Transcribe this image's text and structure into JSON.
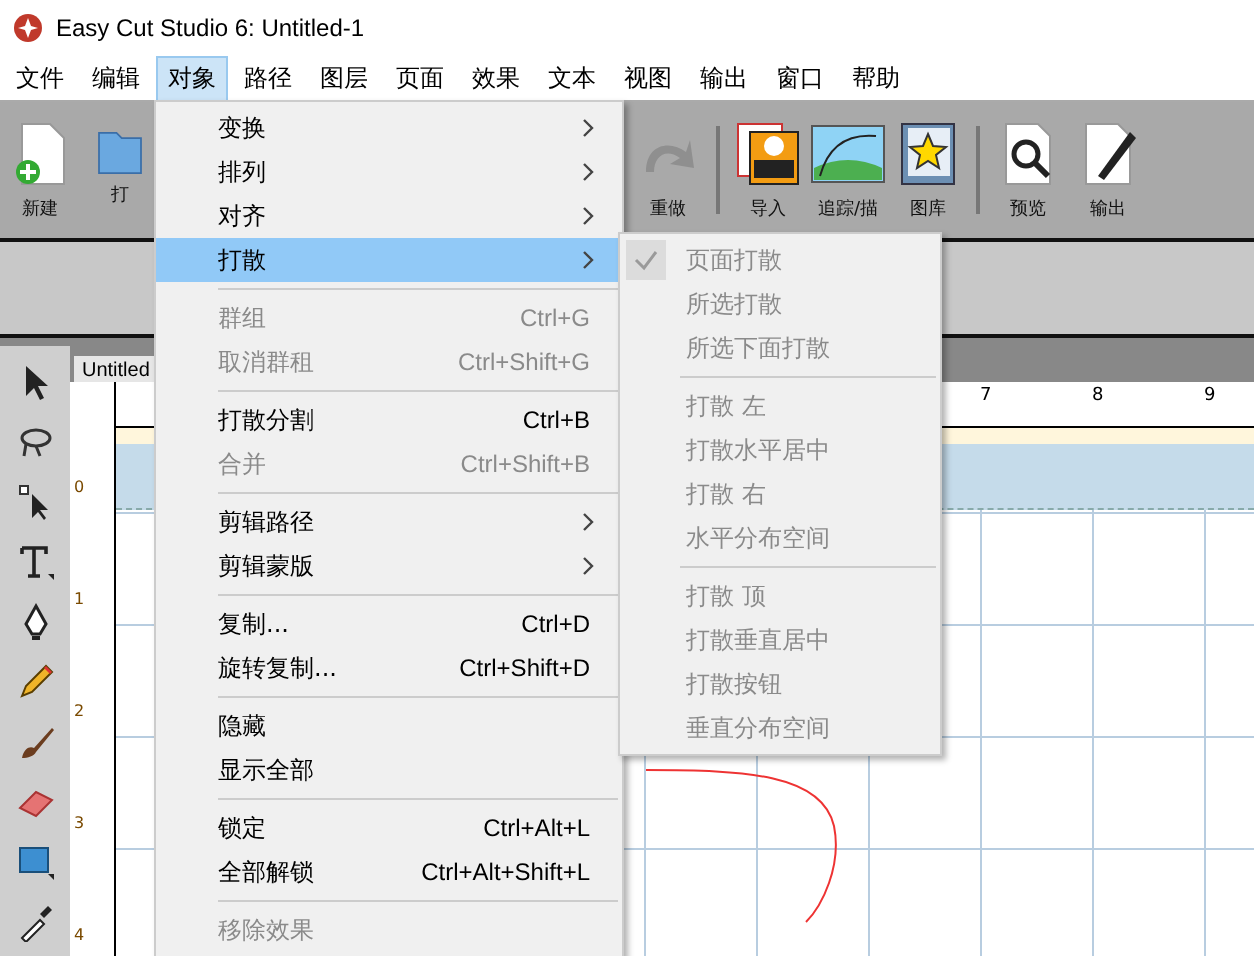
{
  "window": {
    "title": "Easy Cut Studio 6: Untitled-1"
  },
  "menu_bar": [
    {
      "label": "文件",
      "selected": false
    },
    {
      "label": "编辑",
      "selected": false
    },
    {
      "label": "对象",
      "selected": true
    },
    {
      "label": "路径",
      "selected": false
    },
    {
      "label": "图层",
      "selected": false
    },
    {
      "label": "页面",
      "selected": false
    },
    {
      "label": "效果",
      "selected": false
    },
    {
      "label": "文本",
      "selected": false
    },
    {
      "label": "视图",
      "selected": false
    },
    {
      "label": "输出",
      "selected": false
    },
    {
      "label": "窗口",
      "selected": false
    },
    {
      "label": "帮助",
      "selected": false
    }
  ],
  "toolbar": [
    {
      "kind": "new",
      "label": "新建"
    },
    {
      "kind": "open",
      "label": "打"
    },
    {
      "kind": "redo",
      "label": "重做"
    },
    {
      "kind": "import",
      "label": "导入"
    },
    {
      "kind": "trace",
      "label": "追踪/描"
    },
    {
      "kind": "library",
      "label": "图库"
    },
    {
      "kind": "preview",
      "label": "预览"
    },
    {
      "kind": "output",
      "label": "输出"
    }
  ],
  "document_tab": "Untitled",
  "top_ruler": [
    "7",
    "8",
    "9"
  ],
  "left_ruler": [
    "0",
    "1",
    "2",
    "3",
    "4"
  ],
  "object_menu": [
    {
      "kind": "item",
      "label": "变换",
      "submenu": true,
      "disabled": false,
      "selected": false
    },
    {
      "kind": "item",
      "label": "排列",
      "submenu": true,
      "disabled": false,
      "selected": false
    },
    {
      "kind": "item",
      "label": "对齐",
      "submenu": true,
      "disabled": false,
      "selected": false
    },
    {
      "kind": "item",
      "label": "打散",
      "submenu": true,
      "disabled": false,
      "selected": true
    },
    {
      "kind": "separator"
    },
    {
      "kind": "item",
      "label": "群组",
      "shortcut": "Ctrl+G",
      "disabled": true,
      "selected": false
    },
    {
      "kind": "item",
      "label": "取消群租",
      "shortcut": "Ctrl+Shift+G",
      "disabled": true,
      "selected": false
    },
    {
      "kind": "separator"
    },
    {
      "kind": "item",
      "label": "打散分割",
      "shortcut": "Ctrl+B",
      "disabled": false,
      "selected": false
    },
    {
      "kind": "item",
      "label": "合并",
      "shortcut": "Ctrl+Shift+B",
      "disabled": true,
      "selected": false
    },
    {
      "kind": "separator"
    },
    {
      "kind": "item",
      "label": "剪辑路径",
      "submenu": true,
      "disabled": false,
      "selected": false
    },
    {
      "kind": "item",
      "label": "剪辑蒙版",
      "submenu": true,
      "disabled": false,
      "selected": false
    },
    {
      "kind": "separator"
    },
    {
      "kind": "item",
      "label": "复制...",
      "shortcut": "Ctrl+D",
      "disabled": false,
      "selected": false
    },
    {
      "kind": "item",
      "label": "旋转复制...",
      "shortcut": "Ctrl+Shift+D",
      "disabled": false,
      "selected": false
    },
    {
      "kind": "separator"
    },
    {
      "kind": "item",
      "label": "隐藏",
      "disabled": false,
      "selected": false
    },
    {
      "kind": "item",
      "label": "显示全部",
      "disabled": false,
      "selected": false
    },
    {
      "kind": "separator"
    },
    {
      "kind": "item",
      "label": "锁定",
      "shortcut": "Ctrl+Alt+L",
      "disabled": false,
      "selected": false
    },
    {
      "kind": "item",
      "label": "全部解锁",
      "shortcut": "Ctrl+Alt+Shift+L",
      "disabled": false,
      "selected": false
    },
    {
      "kind": "separator"
    },
    {
      "kind": "item",
      "label": "移除效果",
      "disabled": true,
      "selected": false
    }
  ],
  "break_apart_submenu": [
    {
      "kind": "item",
      "label": "页面打散",
      "checked": true,
      "disabled": true
    },
    {
      "kind": "item",
      "label": "所选打散",
      "checked": false,
      "disabled": true
    },
    {
      "kind": "item",
      "label": "所选下面打散",
      "checked": false,
      "disabled": true
    },
    {
      "kind": "separator"
    },
    {
      "kind": "item",
      "label": "打散 左",
      "checked": false,
      "disabled": true
    },
    {
      "kind": "item",
      "label": "打散水平居中",
      "checked": false,
      "disabled": true
    },
    {
      "kind": "item",
      "label": "打散 右",
      "checked": false,
      "disabled": true
    },
    {
      "kind": "item",
      "label": "水平分布空间",
      "checked": false,
      "disabled": true
    },
    {
      "kind": "separator"
    },
    {
      "kind": "item",
      "label": "打散 顶",
      "checked": false,
      "disabled": true
    },
    {
      "kind": "item",
      "label": "打散垂直居中",
      "checked": false,
      "disabled": true
    },
    {
      "kind": "item",
      "label": "打散按钮",
      "checked": false,
      "disabled": true
    },
    {
      "kind": "item",
      "label": "垂直分布空间",
      "checked": false,
      "disabled": true
    }
  ]
}
